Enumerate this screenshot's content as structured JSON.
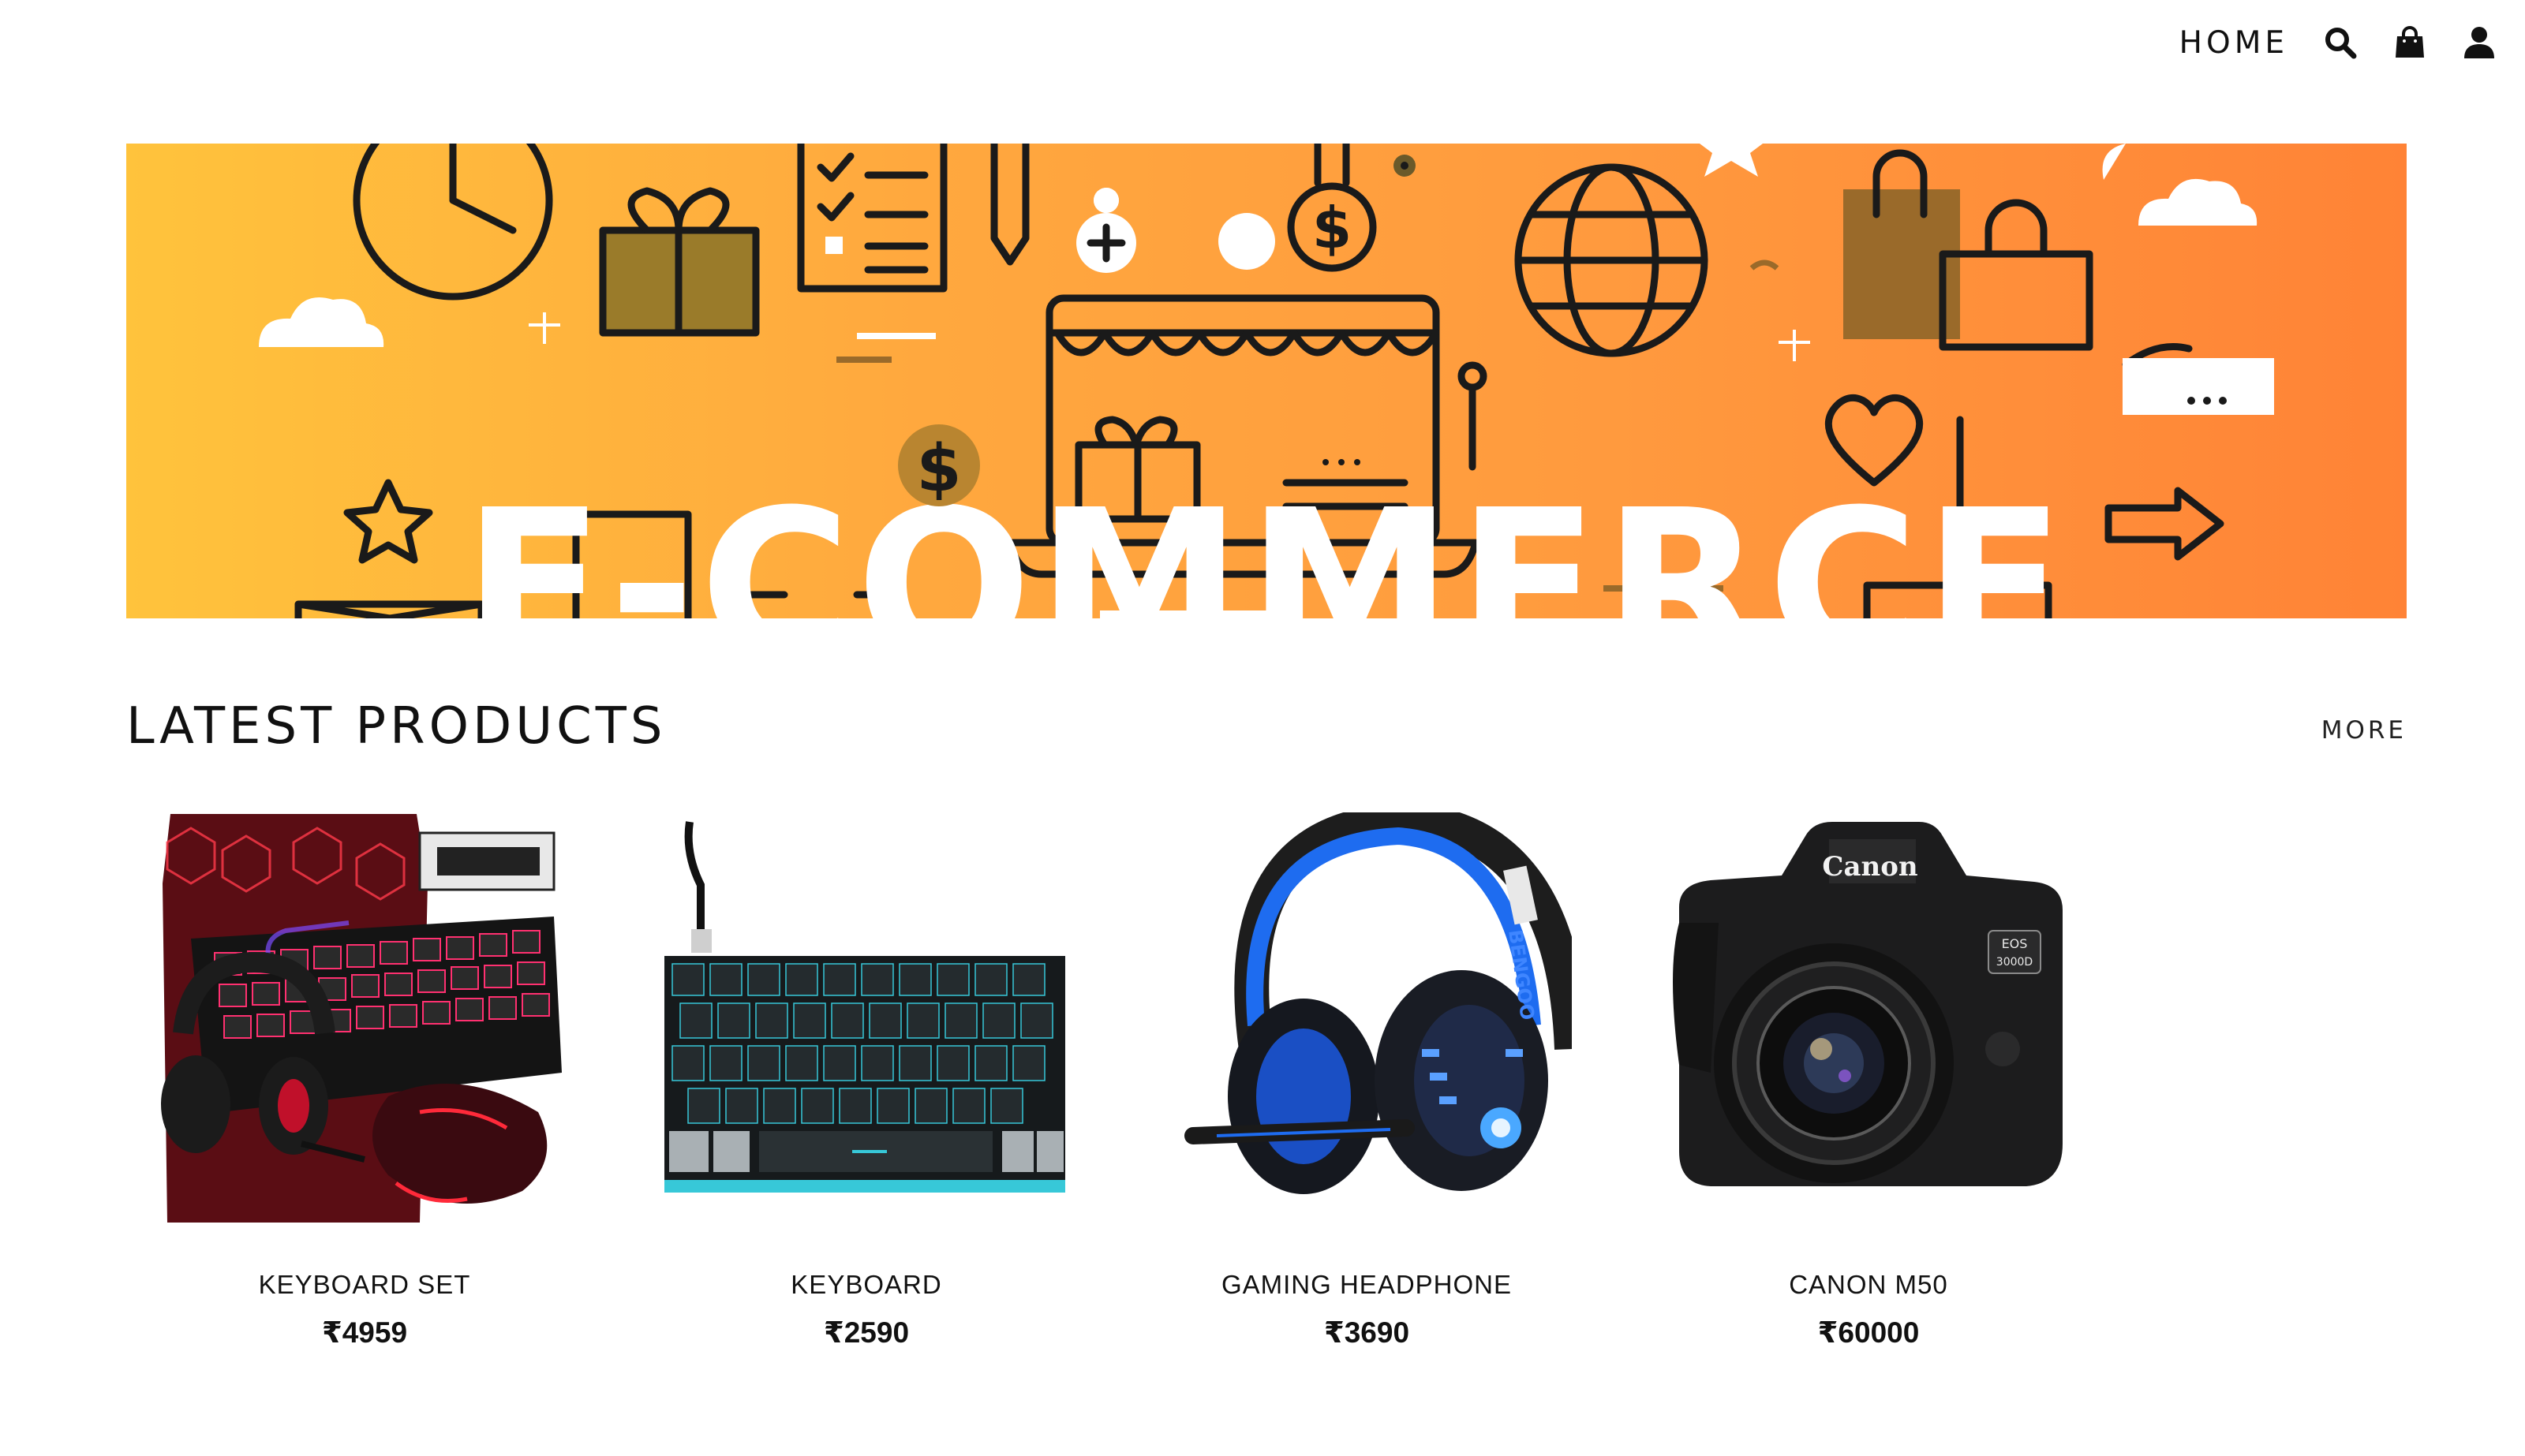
{
  "nav": {
    "home_label": "HOME",
    "icons": [
      "search-icon",
      "shopping-bag-icon",
      "user-icon"
    ]
  },
  "banner": {
    "headline": "E-COMMERCE",
    "colors": {
      "start": "#ffc33c",
      "end": "#ff8336"
    }
  },
  "latest": {
    "title": "LATEST PRODUCTS",
    "more_label": "MORE",
    "products": [
      {
        "name": "KEYBOARD SET",
        "price": "₹4959",
        "image": "keyboard-set-image"
      },
      {
        "name": "KEYBOARD",
        "price": "₹2590",
        "image": "keyboard-image"
      },
      {
        "name": "GAMING HEADPHONE",
        "price": "₹3690",
        "image": "gaming-headphone-image"
      },
      {
        "name": "CANON M50",
        "price": "₹60000",
        "image": "canon-camera-image"
      }
    ]
  }
}
